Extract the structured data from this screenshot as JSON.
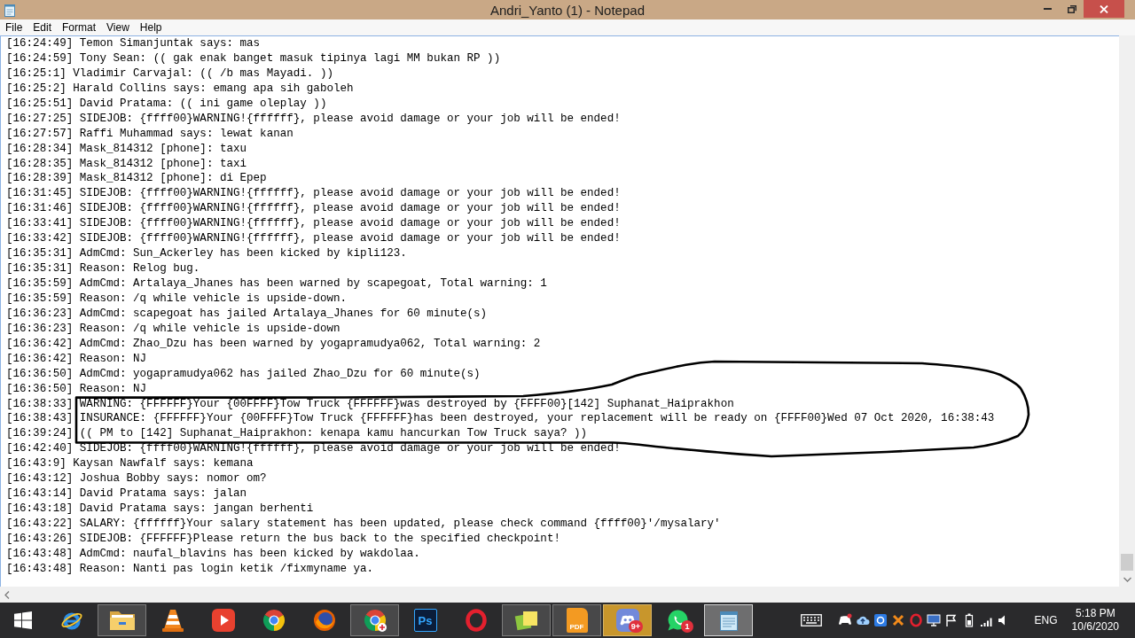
{
  "window": {
    "title": "Andri_Yanto (1) - Notepad"
  },
  "menu": [
    "File",
    "Edit",
    "Format",
    "View",
    "Help"
  ],
  "document": {
    "lines": [
      "[16:24:49] Temon Simanjuntak says: mas",
      "[16:24:59] Tony Sean: (( gak enak banget masuk tipinya lagi MM bukan RP ))",
      "[16:25:1] Vladimir Carvajal: (( /b mas Mayadi. ))",
      "[16:25:2] Harald Collins says: emang apa sih gaboleh",
      "[16:25:51] David Pratama: (( ini game oleplay ))",
      "[16:27:25] SIDEJOB: {ffff00}WARNING!{ffffff}, please avoid damage or your job will be ended!",
      "[16:27:57] Raffi Muhammad says: lewat kanan",
      "[16:28:34] Mask_814312 [phone]: taxu",
      "[16:28:35] Mask_814312 [phone]: taxi",
      "[16:28:39] Mask_814312 [phone]: di Epep",
      "[16:31:45] SIDEJOB: {ffff00}WARNING!{ffffff}, please avoid damage or your job will be ended!",
      "[16:31:46] SIDEJOB: {ffff00}WARNING!{ffffff}, please avoid damage or your job will be ended!",
      "[16:33:41] SIDEJOB: {ffff00}WARNING!{ffffff}, please avoid damage or your job will be ended!",
      "[16:33:42] SIDEJOB: {ffff00}WARNING!{ffffff}, please avoid damage or your job will be ended!",
      "[16:35:31] AdmCmd: Sun_Ackerley has been kicked by kipli123.",
      "[16:35:31] Reason: Relog bug.",
      "[16:35:59] AdmCmd: Artalaya_Jhanes has been warned by scapegoat, Total warning: 1",
      "[16:35:59] Reason: /q while vehicle is upside-down.",
      "[16:36:23] AdmCmd: scapegoat has jailed Artalaya_Jhanes for 60 minute(s)",
      "[16:36:23] Reason: /q while vehicle is upside-down",
      "[16:36:42] AdmCmd: Zhao_Dzu has been warned by yogapramudya062, Total warning: 2",
      "[16:36:42] Reason: NJ",
      "[16:36:50] AdmCmd: yogapramudya062 has jailed Zhao_Dzu for 60 minute(s)",
      "[16:36:50] Reason: NJ",
      "[16:38:33] WARNING: {FFFFFF}Your {00FFFF}Tow Truck {FFFFFF}was destroyed by {FFFF00}[142] Suphanat_Haiprakhon",
      "[16:38:43] INSURANCE: {FFFFFF}Your {00FFFF}Tow Truck {FFFFFF}has been destroyed, your replacement will be ready on {FFFF00}Wed 07 Oct 2020, 16:38:43",
      "[16:39:24] (( PM to [142] Suphanat_Haiprakhon: kenapa kamu hancurkan Tow Truck saya? ))",
      "[16:42:40] SIDEJOB: {ffff00}WARNING!{ffffff}, please avoid damage or your job will be ended!",
      "[16:43:9] Kaysan Nawfalf says: kemana",
      "[16:43:12] Joshua Bobby says: nomor om?",
      "[16:43:14] David Pratama says: jalan",
      "[16:43:18] David Pratama says: jangan berhenti",
      "[16:43:22] SALARY: {ffffff}Your salary statement has been updated, please check command {ffff00}'/mysalary'",
      "[16:43:26] SIDEJOB: {FFFFFF}Please return the bus back to the specified checkpoint!",
      "[16:43:48] AdmCmd: naufal_blavins has been kicked by wakdolaa.",
      "[16:43:48] Reason: Nanti pas login ketik /fixmyname ya."
    ]
  },
  "taskbar": {
    "apps": [
      {
        "running": false,
        "selected": false,
        "flashing": false
      },
      {
        "running": true,
        "selected": false,
        "flashing": false
      },
      {
        "running": false,
        "selected": false,
        "flashing": false
      },
      {
        "running": false,
        "selected": false,
        "flashing": false
      },
      {
        "running": false,
        "selected": false,
        "flashing": false
      },
      {
        "running": false,
        "selected": false,
        "flashing": false
      },
      {
        "running": true,
        "selected": false,
        "flashing": false
      },
      {
        "running": false,
        "selected": false,
        "flashing": false,
        "label": "Ps"
      },
      {
        "running": false,
        "selected": false,
        "flashing": false
      },
      {
        "running": true,
        "selected": false,
        "flashing": false
      },
      {
        "running": true,
        "selected": false,
        "flashing": false,
        "label": "PDF"
      },
      {
        "running": true,
        "selected": false,
        "flashing": true,
        "badge": "9+"
      },
      {
        "running": false,
        "selected": false,
        "flashing": false,
        "badge": "1"
      },
      {
        "running": true,
        "selected": true,
        "flashing": false
      }
    ]
  },
  "tray": {
    "language": "ENG",
    "time": "5:18 PM",
    "date": "10/6/2020"
  }
}
